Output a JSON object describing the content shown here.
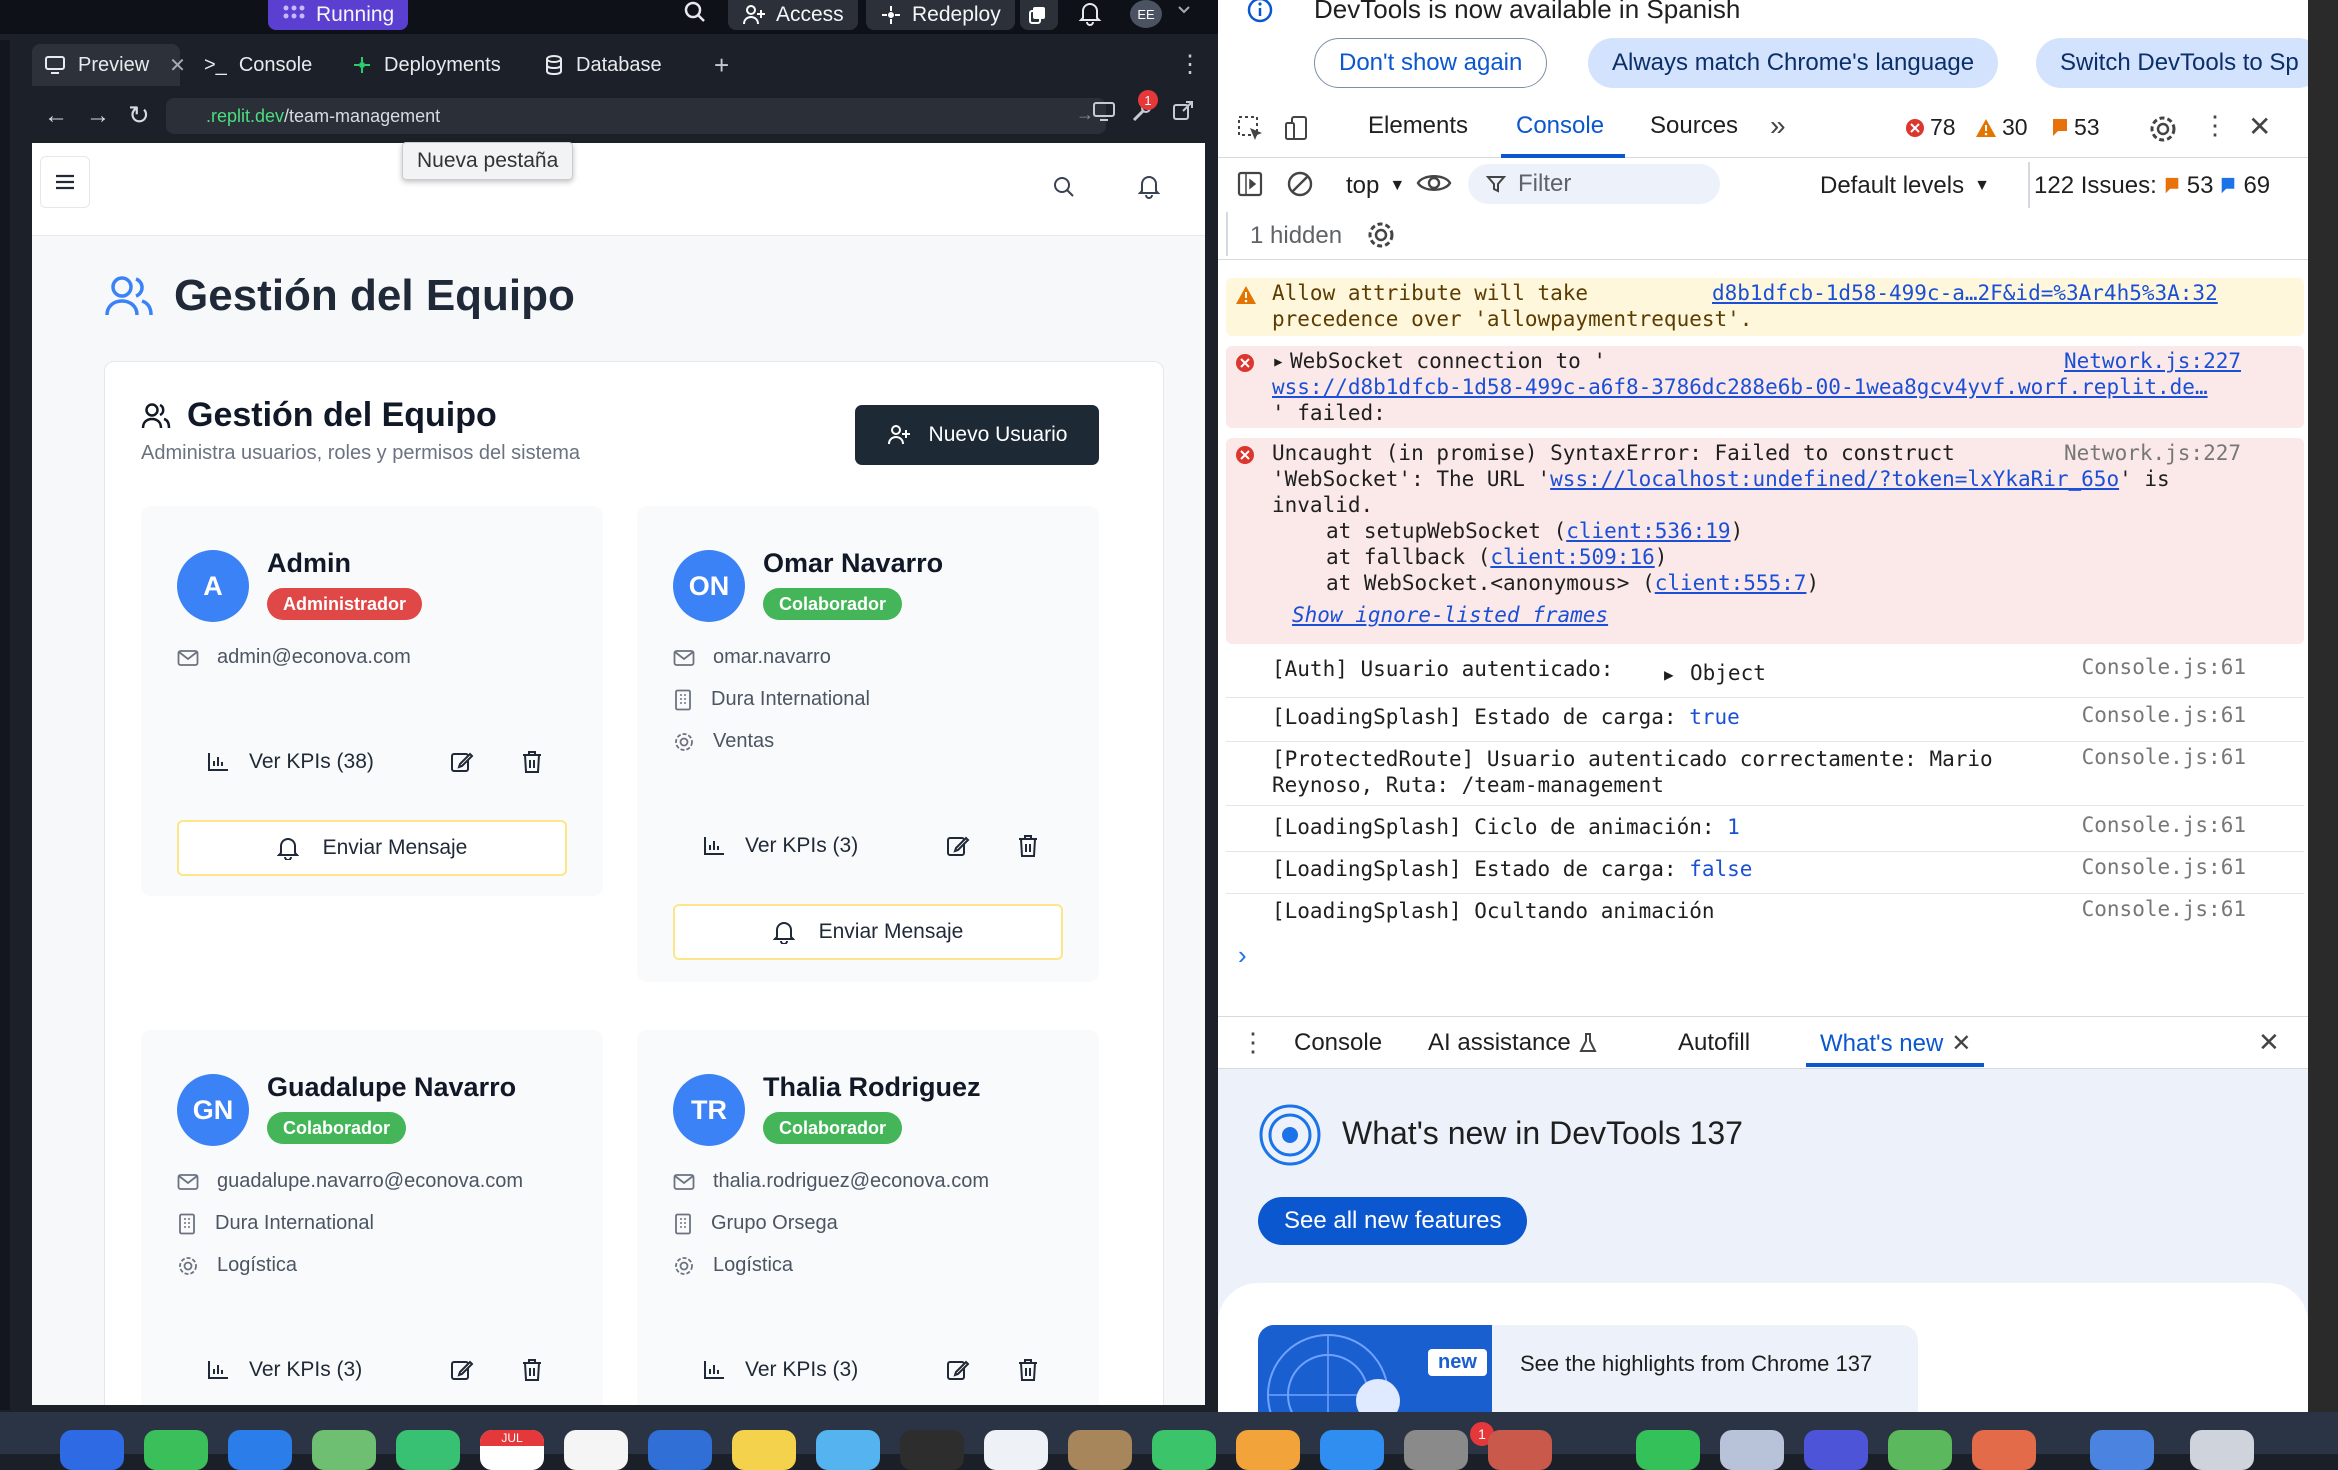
{
  "workspace": {
    "run_status": "Running",
    "access_label": "Access",
    "redeploy_label": "Redeploy",
    "avatar_initials": "EE",
    "tabs": [
      {
        "label": "Preview",
        "icon": "monitor-icon"
      },
      {
        "label": "Console",
        "icon": "terminal-icon"
      },
      {
        "label": "Deployments",
        "icon": "deploy-icon"
      },
      {
        "label": "Database",
        "icon": "database-icon"
      }
    ],
    "url_host": ".replit.dev",
    "url_path": "/team-management",
    "notification_count": "1",
    "tooltip": "Nueva pestaña"
  },
  "app": {
    "page_title": "Gestión del Equipo",
    "panel_title": "Gestión del Equipo",
    "panel_subtitle": "Administra usuarios, roles y permisos del sistema",
    "new_user_label": "Nuevo Usuario",
    "message_label": "Enviar Mensaje",
    "users": [
      {
        "initials": "A",
        "name": "Admin",
        "role": "Administrador",
        "role_color": "#e04848",
        "email": "admin@econova.com",
        "company": "",
        "dept": "",
        "kpi": "Ver KPIs (38)"
      },
      {
        "initials": "ON",
        "name": "Omar Navarro",
        "role": "Colaborador",
        "role_color": "#44b558",
        "email": "omar.navarro",
        "company": "Dura International",
        "dept": "Ventas",
        "kpi": "Ver KPIs (3)"
      },
      {
        "initials": "GN",
        "name": "Guadalupe Navarro",
        "role": "Colaborador",
        "role_color": "#44b558",
        "email": "guadalupe.navarro@econova.com",
        "company": "Dura International",
        "dept": "Logística",
        "kpi": "Ver KPIs (3)"
      },
      {
        "initials": "TR",
        "name": "Thalia Rodriguez",
        "role": "Colaborador",
        "role_color": "#44b558",
        "email": "thalia.rodriguez@econova.com",
        "company": "Grupo Orsega",
        "dept": "Logística",
        "kpi": "Ver KPIs (3)"
      }
    ]
  },
  "devtools": {
    "info_message": "DevTools is now available in Spanish",
    "btn_dont_show": "Don't show again",
    "btn_match": "Always match Chrome's language",
    "btn_switch": "Switch DevTools to Sp",
    "tabs": [
      "Elements",
      "Console",
      "Sources"
    ],
    "error_count": "78",
    "warning_count": "30",
    "issue_count": "53",
    "context": "top",
    "filter_placeholder": "Filter",
    "levels": "Default levels",
    "issues_label": "122 Issues:",
    "issues_flag": "53",
    "issues_info": "69",
    "hidden": "1 hidden",
    "logs": {
      "warn_text1": "Allow attribute will take",
      "warn_text2": "precedence over 'allowpaymentrequest'.",
      "warn_src": "d8b1dfcb-1d58-499c-a…2F&id=%3Ar4h5%3A:32",
      "ws_text": "WebSocket connection to '",
      "ws_url": "wss://d8b1dfcb-1d58-499c-a6f8-3786dc288e6b-00-1wea8gcv4yvf.worf.replit.de…",
      "ws_failed": "' failed:",
      "ws_src": "Network.js:227",
      "err_l1": "Uncaught (in promise) SyntaxError: Failed to construct",
      "err_l2a": "'WebSocket': The URL '",
      "err_l2url": "wss://localhost:undefined/?token=lxYkaRir_65o",
      "err_l2b": "' is",
      "err_l3": "invalid.",
      "err_s1a": "at setupWebSocket (",
      "err_s1b": "client:536:19",
      "err_s2a": "at fallback (",
      "err_s2b": "client:509:16",
      "err_s3a": "at WebSocket.<anonymous> (",
      "err_s3b": "client:555:7",
      "err_src": "Network.js:227",
      "ignore_frames": "Show ignore-listed frames",
      "auth_text": "[Auth] Usuario autenticado:",
      "auth_obj": "Object",
      "l1": "[LoadingSplash] Estado de carga:",
      "l1v": "true",
      "pr1": "[ProtectedRoute] Usuario autenticado correctamente: Mario",
      "pr2": "Reynoso, Ruta: /team-management",
      "l2": "[LoadingSplash] Ciclo de animación:",
      "l2v": "1",
      "l3": "[LoadingSplash] Estado de carga:",
      "l3v": "false",
      "l4": "[LoadingSplash] Ocultando animación",
      "console_src": "Console.js:61"
    },
    "drawer_tabs": [
      "Console",
      "AI assistance",
      "Autofill",
      "What's new"
    ],
    "whats_new_title": "What's new in DevTools 137",
    "see_all": "See all new features",
    "highlight_badge": "new",
    "highlight_text": "See the highlights from Chrome 137"
  },
  "dock": {
    "calendar_month": "JUL",
    "badge": "1"
  }
}
